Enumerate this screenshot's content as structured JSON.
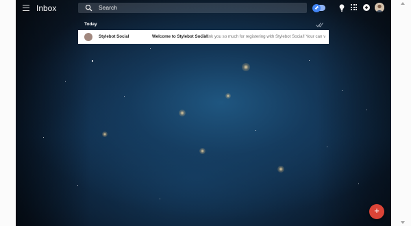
{
  "header": {
    "title": "Inbox",
    "search_placeholder": "Search"
  },
  "sections": [
    {
      "label": "Today",
      "emails": [
        {
          "sender": "Stylebot Social",
          "sender_initial": "",
          "subject": "Welcome to Stylebot Social!",
          "snippet": " – Thank you so much for registering with Stylebot Social! Your can vie..."
        }
      ]
    }
  ],
  "fab": {
    "label": "+"
  },
  "colors": {
    "accent_blue": "#4285f4",
    "fab_red": "#db4437",
    "sender_avatar": "#a1887f"
  },
  "icons": [
    "menu-icon",
    "search-icon",
    "toggle-switch",
    "bulb-icon",
    "apps-icon",
    "notification-icon",
    "sweep-icon"
  ]
}
